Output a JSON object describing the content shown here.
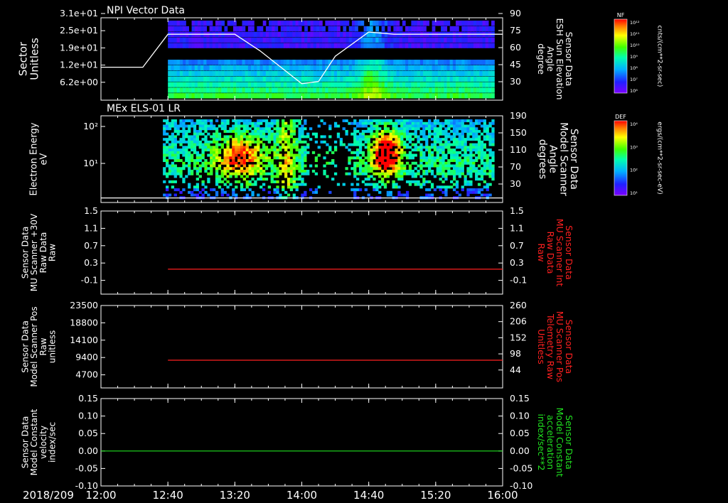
{
  "time_axis": {
    "date_label": "2018/209",
    "ticks": [
      "12:00",
      "12:40",
      "13:20",
      "14:00",
      "14:40",
      "15:20",
      "16:00"
    ]
  },
  "colorbars": [
    {
      "label": "NF",
      "unit": "cnts/(cm**2-sr-sec)",
      "ticks": [
        "10¹²",
        "10¹¹",
        "10¹⁰",
        "10⁹",
        "10⁸",
        "10⁷",
        "10⁶"
      ]
    },
    {
      "label": "DEF",
      "unit": "ergs/(cm**2-sr-sec-eV)",
      "ticks": [
        "10⁴",
        "10³",
        "10²",
        "10¹"
      ]
    }
  ],
  "chart_data": [
    {
      "type": "heatmap",
      "title": "NPI Vector Data",
      "ylabel": [
        "Sector",
        "Unitless"
      ],
      "yticks": [
        "3.1e+01",
        "2.5e+01",
        "1.9e+01",
        "1.2e+01",
        "6.2e+00"
      ],
      "right_ylabel": [
        "Sensor Data",
        "ESH Sun Elevation",
        "Angle",
        "degree"
      ],
      "right_yticks": [
        "90",
        "75",
        "60",
        "45",
        "30"
      ],
      "right_ylim": [
        15,
        90
      ],
      "overlay_line": {
        "name": "ESH Sun Elevation Angle",
        "x": [
          "12:00",
          "12:25",
          "12:40",
          "13:20",
          "13:35",
          "14:00",
          "14:10",
          "14:20",
          "14:40",
          "14:55",
          "15:20",
          "16:00"
        ],
        "y": [
          45,
          45,
          75,
          75,
          60,
          30,
          32,
          55,
          77,
          75,
          75,
          75
        ]
      }
    },
    {
      "type": "heatmap",
      "title": "MEx ELS-01 LR",
      "ylabel": [
        "Electron Energy",
        "eV"
      ],
      "yticks": [
        "10²",
        "10¹"
      ],
      "right_ylabel": [
        "Sensor Data",
        "Model Scanner",
        "Angle",
        "degrees"
      ],
      "right_yticks": [
        "190",
        "150",
        "110",
        "70",
        "30"
      ],
      "right_ylim": [
        0,
        190
      ],
      "overlay_line": {
        "name": "Model Scanner Angle",
        "x": [
          "12:00",
          "16:00"
        ],
        "y": [
          10,
          10
        ]
      }
    },
    {
      "type": "line",
      "ylabel": [
        "Sensor Data",
        "MU Scanner +30V",
        "Raw Data",
        "Raw"
      ],
      "yticks": [
        "1.5",
        "1.1",
        "0.7",
        "0.3",
        "-0.1"
      ],
      "ylim": [
        -0.5,
        1.5
      ],
      "right_ylabel": [
        "Sensor Data",
        "MU Scanner Int",
        "Raw Data",
        "Raw"
      ],
      "right_yticks": [
        "1.5",
        "1.1",
        "0.7",
        "0.3",
        "-0.1"
      ],
      "series": [
        {
          "name": "MU Scanner Int Raw Data",
          "color": "#ff2020",
          "x": [
            "12:40",
            "16:00"
          ],
          "y": [
            0.1,
            0.1
          ]
        }
      ]
    },
    {
      "type": "line",
      "ylabel": [
        "Sensor Data",
        "Model Scanner Pos",
        "Raw",
        "unitless"
      ],
      "yticks": [
        "23500",
        "18800",
        "14100",
        "9400",
        "4700"
      ],
      "ylim": [
        0,
        23500
      ],
      "right_ylabel": [
        "Sensor Data",
        "MU Scanner Pos",
        "Telemetry Raw",
        "Unitless"
      ],
      "right_yticks": [
        "260",
        "206",
        "152",
        "98",
        "44"
      ],
      "series": [
        {
          "name": "MU Scanner Pos Telemetry Raw",
          "color": "#ff2020",
          "x": [
            "12:40",
            "16:00"
          ],
          "y": [
            7900,
            7900
          ]
        }
      ]
    },
    {
      "type": "line",
      "ylabel": [
        "Sensor Data",
        "Model Constant",
        "velocity",
        "index/sec"
      ],
      "yticks": [
        "0.15",
        "0.10",
        "0.05",
        "0.00",
        "-0.05",
        "-0.10"
      ],
      "ylim": [
        -0.1,
        0.15
      ],
      "right_ylabel": [
        "Sensor Data",
        "Model Constant",
        "acceleration",
        "index/sec**2"
      ],
      "right_yticks": [
        "0.15",
        "0.10",
        "0.05",
        "0.00",
        "-0.05",
        "-0.10"
      ],
      "series": [
        {
          "name": "Model Constant",
          "color": "#20e020",
          "x": [
            "12:00",
            "16:00"
          ],
          "y": [
            0.0,
            0.0
          ]
        }
      ]
    }
  ]
}
